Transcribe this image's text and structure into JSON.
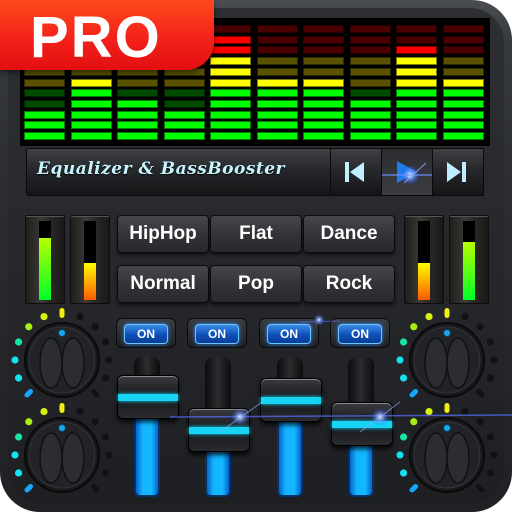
{
  "badge": {
    "label": "PRO",
    "color": "#f3221a"
  },
  "spectrum": {
    "segments_per_column": 11,
    "zones": {
      "red": [
        9,
        11
      ],
      "yellow": [
        6,
        8
      ],
      "green": [
        1,
        5
      ]
    },
    "colors": {
      "green_on": "#00ff00",
      "green_off": "#004a00",
      "yellow_on": "#ffff00",
      "yellow_off": "#5a5200",
      "red_on": "#ff0000",
      "red_off": "#4a0000"
    },
    "levels": [
      3,
      6,
      4,
      3,
      10,
      6,
      6,
      4,
      9,
      6
    ]
  },
  "titlebar": {
    "title": "Equalizer & BassBooster"
  },
  "transport": {
    "prev_icon": "skip-previous-icon",
    "play_icon": "play-icon",
    "next_icon": "skip-next-icon",
    "active": "play"
  },
  "meters": {
    "left": [
      0.78,
      0.47
    ],
    "right": [
      0.47,
      0.73
    ]
  },
  "presets": [
    {
      "label": "HipHop"
    },
    {
      "label": "Flat"
    },
    {
      "label": "Dance"
    },
    {
      "label": "Normal"
    },
    {
      "label": "Pop"
    },
    {
      "label": "Rock"
    }
  ],
  "toggles": [
    {
      "label": "ON"
    },
    {
      "label": "ON"
    },
    {
      "label": "ON"
    },
    {
      "label": "ON"
    }
  ],
  "sliders": [
    {
      "value": 0.75
    },
    {
      "value": 0.45
    },
    {
      "value": 0.72
    },
    {
      "value": 0.5
    }
  ],
  "knobs": [
    {
      "name": "top-left",
      "lit": 7,
      "total": 13
    },
    {
      "name": "bottom-left",
      "lit": 7,
      "total": 13
    },
    {
      "name": "top-right",
      "lit": 7,
      "total": 13
    },
    {
      "name": "bottom-right",
      "lit": 7,
      "total": 13
    }
  ]
}
